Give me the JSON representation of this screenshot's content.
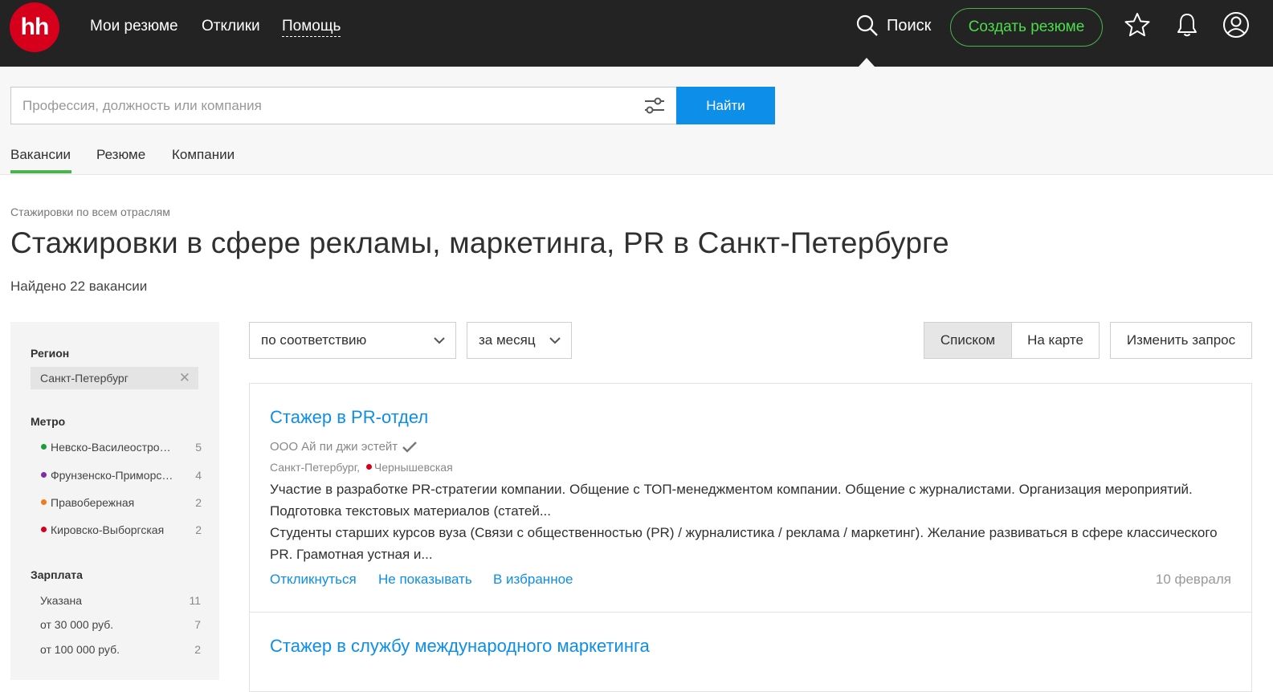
{
  "header": {
    "logo_text": "hh",
    "nav": [
      "Мои резюме",
      "Отклики",
      "Помощь"
    ],
    "search_label": "Поиск",
    "create_resume": "Создать резюме"
  },
  "search": {
    "placeholder": "Профессия, должность или компания",
    "find_button": "Найти",
    "tabs": [
      "Вакансии",
      "Резюме",
      "Компании"
    ],
    "active_tab": "Вакансии"
  },
  "page": {
    "breadcrumb": "Стажировки по всем отраслям",
    "title": "Стажировки в сфере рекламы, маркетинга, PR в Санкт-Петербурге",
    "found": "Найдено 22 вакансии"
  },
  "sidebar": {
    "region_heading": "Регион",
    "region_value": "Санкт-Петербург",
    "metro_heading": "Метро",
    "metro": [
      {
        "label": "Невско-Василеостровская",
        "count": "5",
        "color": "#1a9e3c"
      },
      {
        "label": "Фрунзенско-Приморская",
        "count": "4",
        "color": "#7b2fa6"
      },
      {
        "label": "Правобережная",
        "count": "2",
        "color": "#ef7b1a"
      },
      {
        "label": "Кировско-Выборгская",
        "count": "2",
        "color": "#d6001c"
      }
    ],
    "salary_heading": "Зарплата",
    "salary": [
      {
        "label": "Указана",
        "count": "11"
      },
      {
        "label": "от 30 000 руб.",
        "count": "7"
      },
      {
        "label": "от 100 000 руб.",
        "count": "2"
      }
    ]
  },
  "controls": {
    "sort": "по соответствию",
    "period": "за месяц",
    "view_list": "Списком",
    "view_map": "На карте",
    "change_query": "Изменить запрос"
  },
  "vacancies": [
    {
      "title": "Стажер в PR-отдел",
      "company": "ООО Ай пи джи эстейт",
      "city": "Санкт-Петербург,",
      "metro": "Чернышевская",
      "metro_color": "#d6001c",
      "description_1": "Участие в разработке PR-стратегии компании. Общение с ТОП-менеджментом компании. Общение с журналистами. Организация мероприятий. Подготовка текстовых материалов (статей...",
      "description_2": "Студенты старших курсов вуза (Связи с общественностью (PR) / журналистика / реклама / маркетинг). Желание развиваться в сфере классического PR. Грамотная устная и...",
      "actions": [
        "Откликнуться",
        "Не показывать",
        "В избранное"
      ],
      "date": "10 февраля"
    },
    {
      "title": "Стажер в службу международного маркетинга"
    }
  ],
  "colors": {
    "brand_red": "#d6001c",
    "accent_blue": "#0d8ee8",
    "accent_green": "#4bb34b",
    "header_bg": "#232323"
  }
}
